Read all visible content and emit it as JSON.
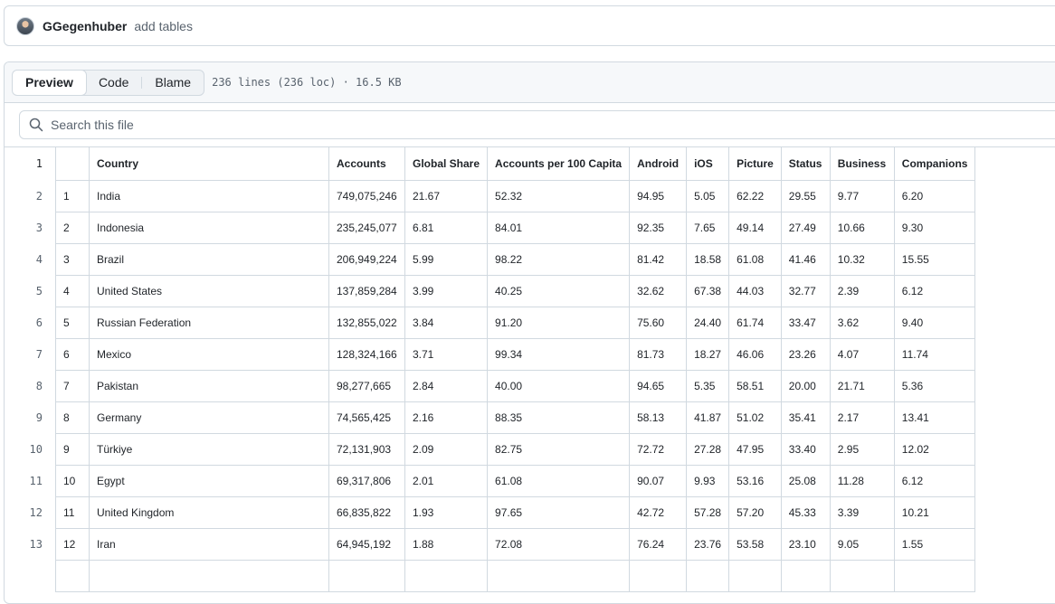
{
  "commit": {
    "author": "GGegenhuber",
    "message": "add tables"
  },
  "file_header": {
    "tabs": [
      "Preview",
      "Code",
      "Blame"
    ],
    "active_tab": "Preview",
    "info": "236 lines (236 loc) · 16.5 KB"
  },
  "search": {
    "placeholder": "Search this file"
  },
  "table": {
    "line_numbers": [
      "1",
      "2",
      "3",
      "4",
      "5",
      "6",
      "7",
      "8",
      "9",
      "10",
      "11",
      "12",
      "13"
    ],
    "headers": [
      "",
      "Country",
      "Accounts",
      "Global Share",
      "Accounts per 100 Capita",
      "Android",
      "iOS",
      "Picture",
      "Status",
      "Business",
      "Companions"
    ],
    "rows": [
      [
        "1",
        "India",
        "749,075,246",
        "21.67",
        "52.32",
        "94.95",
        "5.05",
        "62.22",
        "29.55",
        "9.77",
        "6.20"
      ],
      [
        "2",
        "Indonesia",
        "235,245,077",
        "6.81",
        "84.01",
        "92.35",
        "7.65",
        "49.14",
        "27.49",
        "10.66",
        "9.30"
      ],
      [
        "3",
        "Brazil",
        "206,949,224",
        "5.99",
        "98.22",
        "81.42",
        "18.58",
        "61.08",
        "41.46",
        "10.32",
        "15.55"
      ],
      [
        "4",
        "United States",
        "137,859,284",
        "3.99",
        "40.25",
        "32.62",
        "67.38",
        "44.03",
        "32.77",
        "2.39",
        "6.12"
      ],
      [
        "5",
        "Russian Federation",
        "132,855,022",
        "3.84",
        "91.20",
        "75.60",
        "24.40",
        "61.74",
        "33.47",
        "3.62",
        "9.40"
      ],
      [
        "6",
        "Mexico",
        "128,324,166",
        "3.71",
        "99.34",
        "81.73",
        "18.27",
        "46.06",
        "23.26",
        "4.07",
        "11.74"
      ],
      [
        "7",
        "Pakistan",
        "98,277,665",
        "2.84",
        "40.00",
        "94.65",
        "5.35",
        "58.51",
        "20.00",
        "21.71",
        "5.36"
      ],
      [
        "8",
        "Germany",
        "74,565,425",
        "2.16",
        "88.35",
        "58.13",
        "41.87",
        "51.02",
        "35.41",
        "2.17",
        "13.41"
      ],
      [
        "9",
        "Türkiye",
        "72,131,903",
        "2.09",
        "82.75",
        "72.72",
        "27.28",
        "47.95",
        "33.40",
        "2.95",
        "12.02"
      ],
      [
        "10",
        "Egypt",
        "69,317,806",
        "2.01",
        "61.08",
        "90.07",
        "9.93",
        "53.16",
        "25.08",
        "11.28",
        "6.12"
      ],
      [
        "11",
        "United Kingdom",
        "66,835,822",
        "1.93",
        "97.65",
        "42.72",
        "57.28",
        "57.20",
        "45.33",
        "3.39",
        "10.21"
      ],
      [
        "12",
        "Iran",
        "64,945,192",
        "1.88",
        "72.08",
        "76.24",
        "23.76",
        "53.58",
        "23.10",
        "9.05",
        "1.55"
      ]
    ]
  }
}
